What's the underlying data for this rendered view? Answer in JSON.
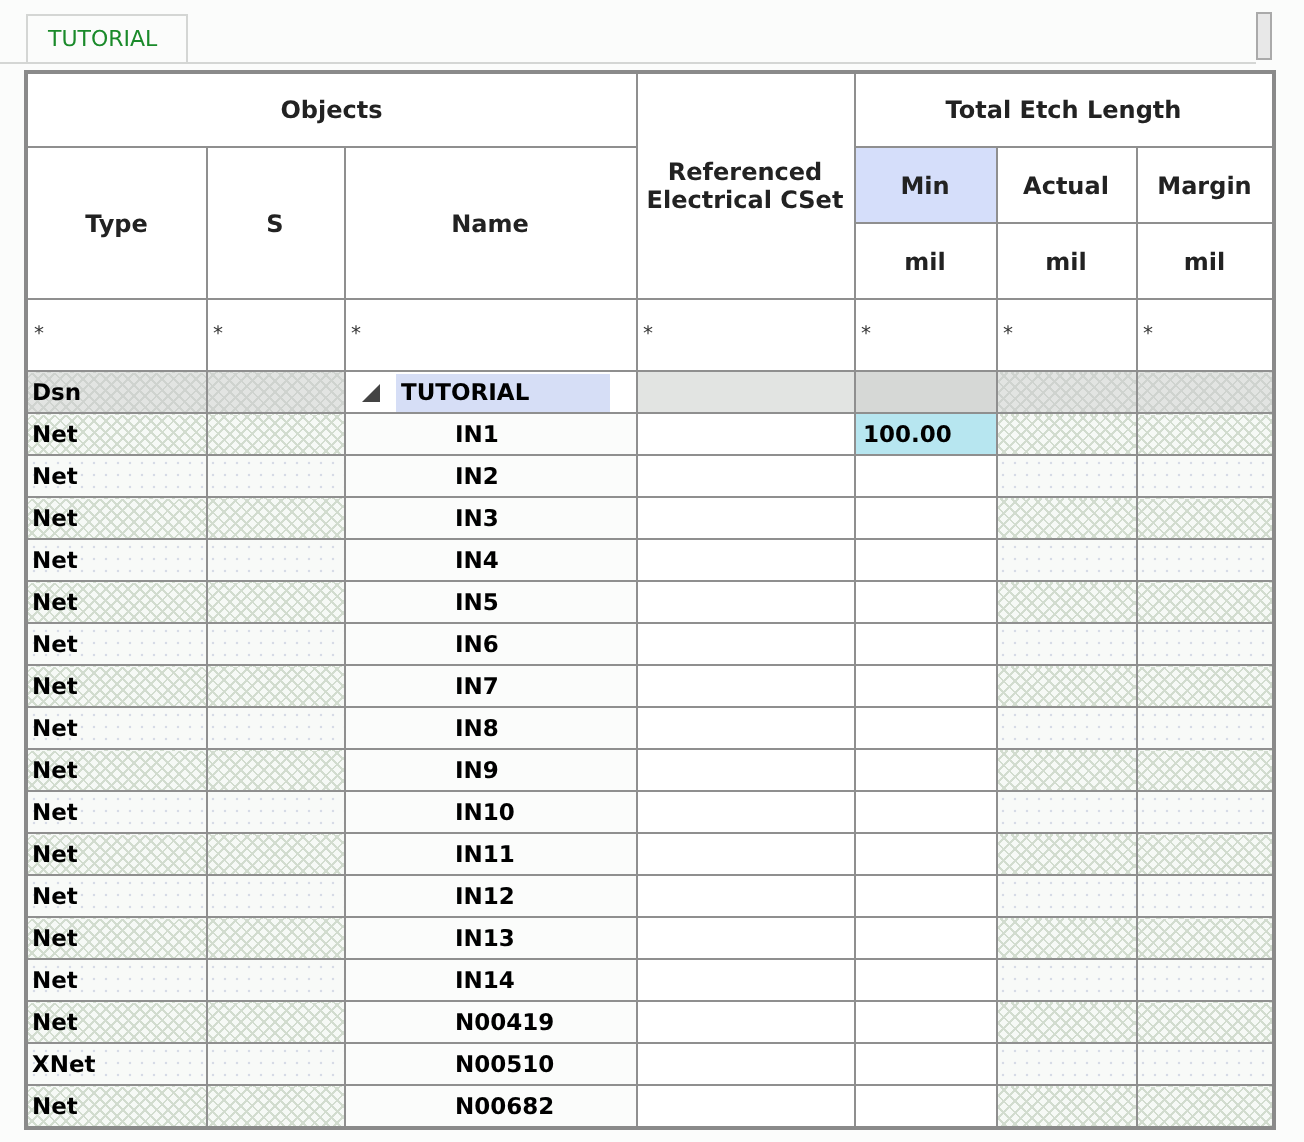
{
  "tabs": [
    {
      "label": "TUTORIAL",
      "selected": true
    }
  ],
  "table": {
    "group_headers": [
      {
        "label": "Objects"
      },
      {
        "label": "Referenced Electrical CSet"
      },
      {
        "label": "Total Etch Length"
      }
    ],
    "columns": [
      {
        "label": "Type"
      },
      {
        "label": "S"
      },
      {
        "label": "Name"
      },
      {
        "label": "Min",
        "unit": "mil",
        "selected": true
      },
      {
        "label": "Actual",
        "unit": "mil",
        "selected": false
      },
      {
        "label": "Margin",
        "unit": "mil",
        "selected": false
      }
    ],
    "filters": [
      "*",
      "*",
      "*",
      "*",
      "*",
      "*",
      "*"
    ],
    "rows": [
      {
        "kind": "design",
        "type": "Dsn",
        "name": "TUTORIAL",
        "expanded": true,
        "selected": true
      },
      {
        "kind": "net",
        "type": "Net",
        "name": "IN1",
        "min": "100.00",
        "selected": false
      },
      {
        "kind": "net",
        "type": "Net",
        "name": "IN2",
        "selected": false
      },
      {
        "kind": "net",
        "type": "Net",
        "name": "IN3",
        "selected": false
      },
      {
        "kind": "net",
        "type": "Net",
        "name": "IN4",
        "selected": false
      },
      {
        "kind": "net",
        "type": "Net",
        "name": "IN5",
        "selected": false
      },
      {
        "kind": "net",
        "type": "Net",
        "name": "IN6",
        "selected": false
      },
      {
        "kind": "net",
        "type": "Net",
        "name": "IN7",
        "selected": false
      },
      {
        "kind": "net",
        "type": "Net",
        "name": "IN8",
        "selected": false
      },
      {
        "kind": "net",
        "type": "Net",
        "name": "IN9",
        "selected": false
      },
      {
        "kind": "net",
        "type": "Net",
        "name": "IN10",
        "selected": false
      },
      {
        "kind": "net",
        "type": "Net",
        "name": "IN11",
        "selected": false
      },
      {
        "kind": "net",
        "type": "Net",
        "name": "IN12",
        "selected": false
      },
      {
        "kind": "net",
        "type": "Net",
        "name": "IN13",
        "selected": false
      },
      {
        "kind": "net",
        "type": "Net",
        "name": "IN14",
        "selected": false
      },
      {
        "kind": "net",
        "type": "Net",
        "name": "N00419",
        "selected": false
      },
      {
        "kind": "net",
        "type": "XNet",
        "name": "N00510",
        "selected": false
      },
      {
        "kind": "net",
        "type": "Net",
        "name": "N00682",
        "selected": false
      }
    ]
  }
}
